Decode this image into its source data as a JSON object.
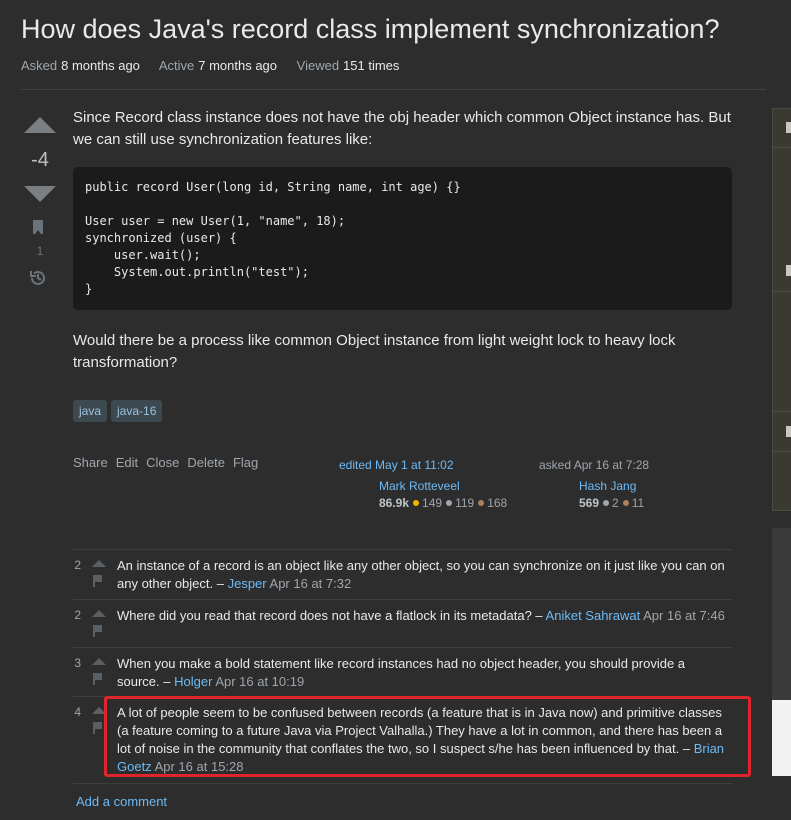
{
  "question": {
    "title": "How does Java's record class implement synchronization?",
    "meta": [
      {
        "label": "Asked",
        "value": "8 months ago"
      },
      {
        "label": "Active",
        "value": "7 months ago"
      },
      {
        "label": "Viewed",
        "value": "151 times"
      }
    ],
    "score": "-4",
    "bookmarks": "1",
    "body_paragraph_1": "Since Record class instance does not have the obj header which common Object instance has. But we can still use synchronization features like:",
    "code": "public record User(long id, String name, int age) {}\n\nUser user = new User(1, \"name\", 18);\nsynchronized (user) {\n    user.wait();\n    System.out.println(\"test\");\n}",
    "body_paragraph_2": "Would there be a process like common Object instance from light weight lock to heavy lock transformation?",
    "tags": [
      "java",
      "java-16"
    ],
    "menu": [
      "Share",
      "Edit",
      "Close",
      "Delete",
      "Flag"
    ],
    "edited": {
      "label": "edited May 1 at 11:02",
      "user": "Mark Rotteveel",
      "rep": "86.9k",
      "gold": "149",
      "silver": "119",
      "bronze": "168"
    },
    "asked": {
      "label": "asked Apr 16 at 7:28",
      "user": "Hash Jang",
      "rep": "569",
      "silver": "2",
      "bronze": "11"
    }
  },
  "comments": [
    {
      "score": "2",
      "text": "An instance of a record is an object like any other object, so you can synchronize on it just like you can on any other object. –",
      "user": "Jesper",
      "date": "Apr 16 at 7:32"
    },
    {
      "score": "2",
      "text": "Where did you read that record does not have a flatlock in its metadata? –",
      "user": "Aniket Sahrawat",
      "date": "Apr 16 at 7:46"
    },
    {
      "score": "3",
      "text": "When you make a bold statement like record instances had no object header, you should provide a source. –",
      "user": "Holger",
      "date": "Apr 16 at 10:19"
    },
    {
      "score": "4",
      "text": "A lot of people seem to be confused between records (a feature that is in Java now) and primitive classes (a feature coming to a future Java via Project Valhalla.) They have a lot in common, and there has been a lot of noise in the community that conflates the two, so I suspect s/he has been influenced by that. –",
      "user": "Brian Goetz",
      "date": "Apr 16 at 15:28"
    }
  ],
  "add_comment": "Add a comment",
  "colors": {
    "link": "#6cbbf7",
    "highlight": "#e0242b",
    "background": "#2d2d2d"
  }
}
